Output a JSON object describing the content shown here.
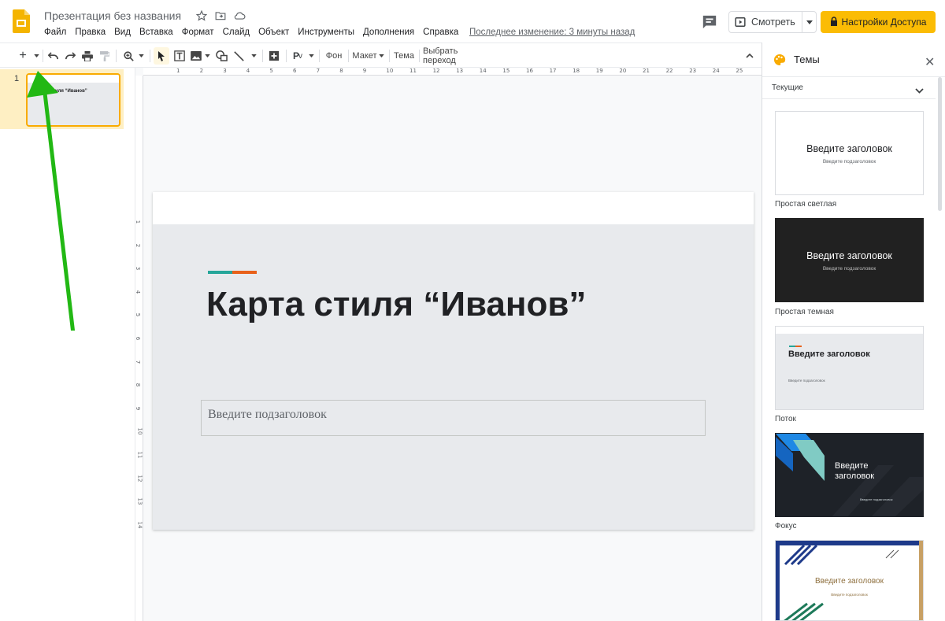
{
  "app": {
    "doc_title": "Презентация без названия",
    "menu": [
      "Файл",
      "Правка",
      "Вид",
      "Вставка",
      "Формат",
      "Слайд",
      "Объект",
      "Инструменты",
      "Дополнения",
      "Справка"
    ],
    "last_edit": "Последнее изменение: 3 минуты назад",
    "view_button": "Смотреть",
    "access_button": "Настройки Доступа"
  },
  "toolbar": {
    "background": "Фон",
    "layout": "Макет",
    "theme": "Тема",
    "transition": "Выбрать переход"
  },
  "filmstrip": {
    "slides": [
      {
        "number": "1",
        "thumb_title": "Карта стиля “Иванов”"
      }
    ]
  },
  "ruler": {
    "top": [
      "1",
      "2",
      "3",
      "4",
      "5",
      "6",
      "7",
      "8",
      "9",
      "10",
      "11",
      "12",
      "13",
      "14",
      "15",
      "16",
      "17",
      "18",
      "19",
      "20",
      "21",
      "22",
      "23",
      "24",
      "25"
    ],
    "left": [
      "1",
      "2",
      "3",
      "4",
      "5",
      "6",
      "7",
      "8",
      "9",
      "10",
      "11",
      "12",
      "13",
      "14"
    ]
  },
  "slide": {
    "title": "Карта стиля “Иванов”",
    "subtitle_placeholder": "Введите подзаголовок"
  },
  "themes": {
    "panel_title": "Темы",
    "section": "Текущие",
    "items": [
      {
        "name": "Простая светлая",
        "preview_title": "Введите заголовок",
        "preview_sub": "Введите подзаголовок"
      },
      {
        "name": "Простая темная",
        "preview_title": "Введите заголовок",
        "preview_sub": "Введите подзаголовок"
      },
      {
        "name": "Поток",
        "preview_title": "Введите заголовок",
        "preview_sub": "Введите подзаголовок"
      },
      {
        "name": "Фокус",
        "preview_title": "Введите заголовок",
        "preview_sub": "Введите подзаголовок"
      },
      {
        "name": "",
        "preview_title": "Введите заголовок",
        "preview_sub": "Введите подзаголовок"
      }
    ]
  },
  "colors": {
    "accent_yellow": "#fbbc04",
    "selection": "#feefc3",
    "annotation_arrow": "#22b814",
    "accent_teal": "#26a69a",
    "accent_orange": "#e8611a"
  }
}
